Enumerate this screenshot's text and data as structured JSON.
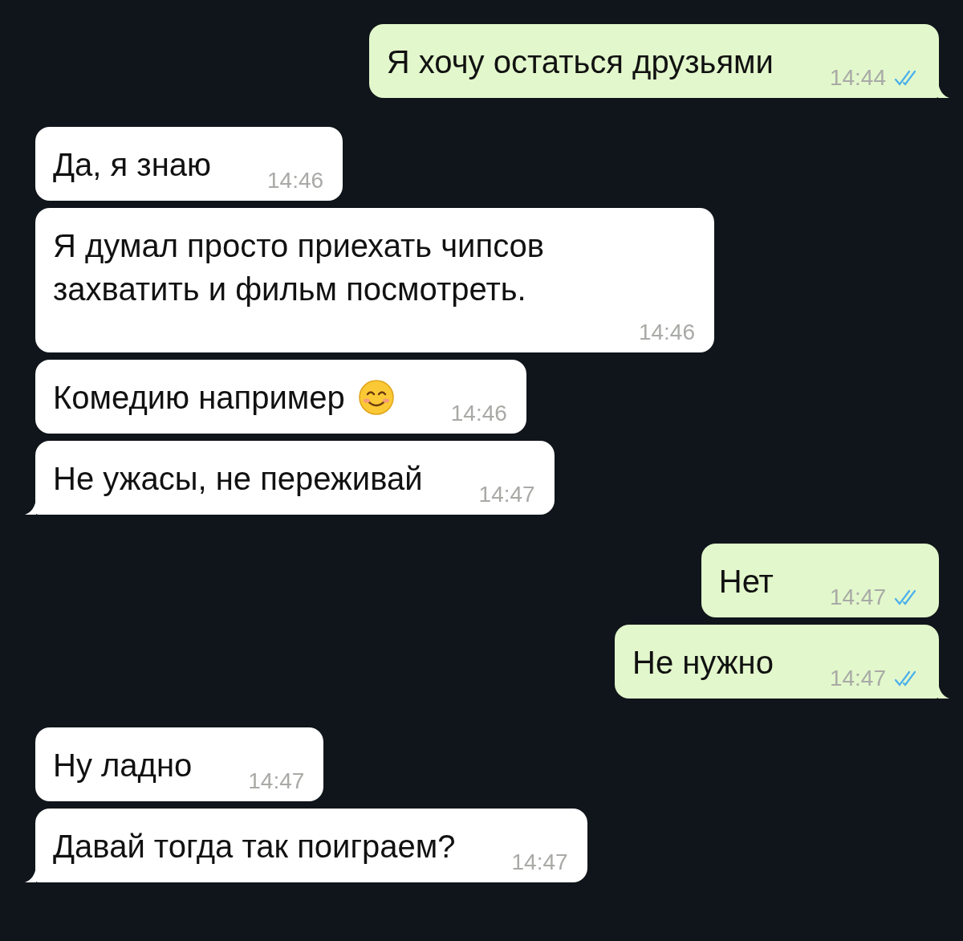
{
  "messages": [
    {
      "kind": "sent",
      "text": "Я хочу остаться друзьями",
      "time": "14:44",
      "read": true,
      "tail": true
    },
    {
      "kind": "received",
      "text": "Да, я знаю",
      "time": "14:46",
      "tail": false
    },
    {
      "kind": "received",
      "text": "Я думал просто приехать чипсов захватить и фильм посмотреть.",
      "time": "14:46",
      "tail": false
    },
    {
      "kind": "received",
      "text": "Комедию например",
      "emoji": true,
      "time": "14:46",
      "tail": false
    },
    {
      "kind": "received",
      "text": "Не ужасы, не переживай",
      "time": "14:47",
      "tail": true
    },
    {
      "kind": "sent",
      "text": "Нет",
      "time": "14:47",
      "read": true,
      "tail": false
    },
    {
      "kind": "sent",
      "text": "Не нужно",
      "time": "14:47",
      "read": true,
      "tail": true
    },
    {
      "kind": "received",
      "text": "Ну ладно",
      "time": "14:47",
      "tail": false
    },
    {
      "kind": "received",
      "text": "Давай тогда так поиграем?",
      "time": "14:47",
      "tail": true
    }
  ]
}
